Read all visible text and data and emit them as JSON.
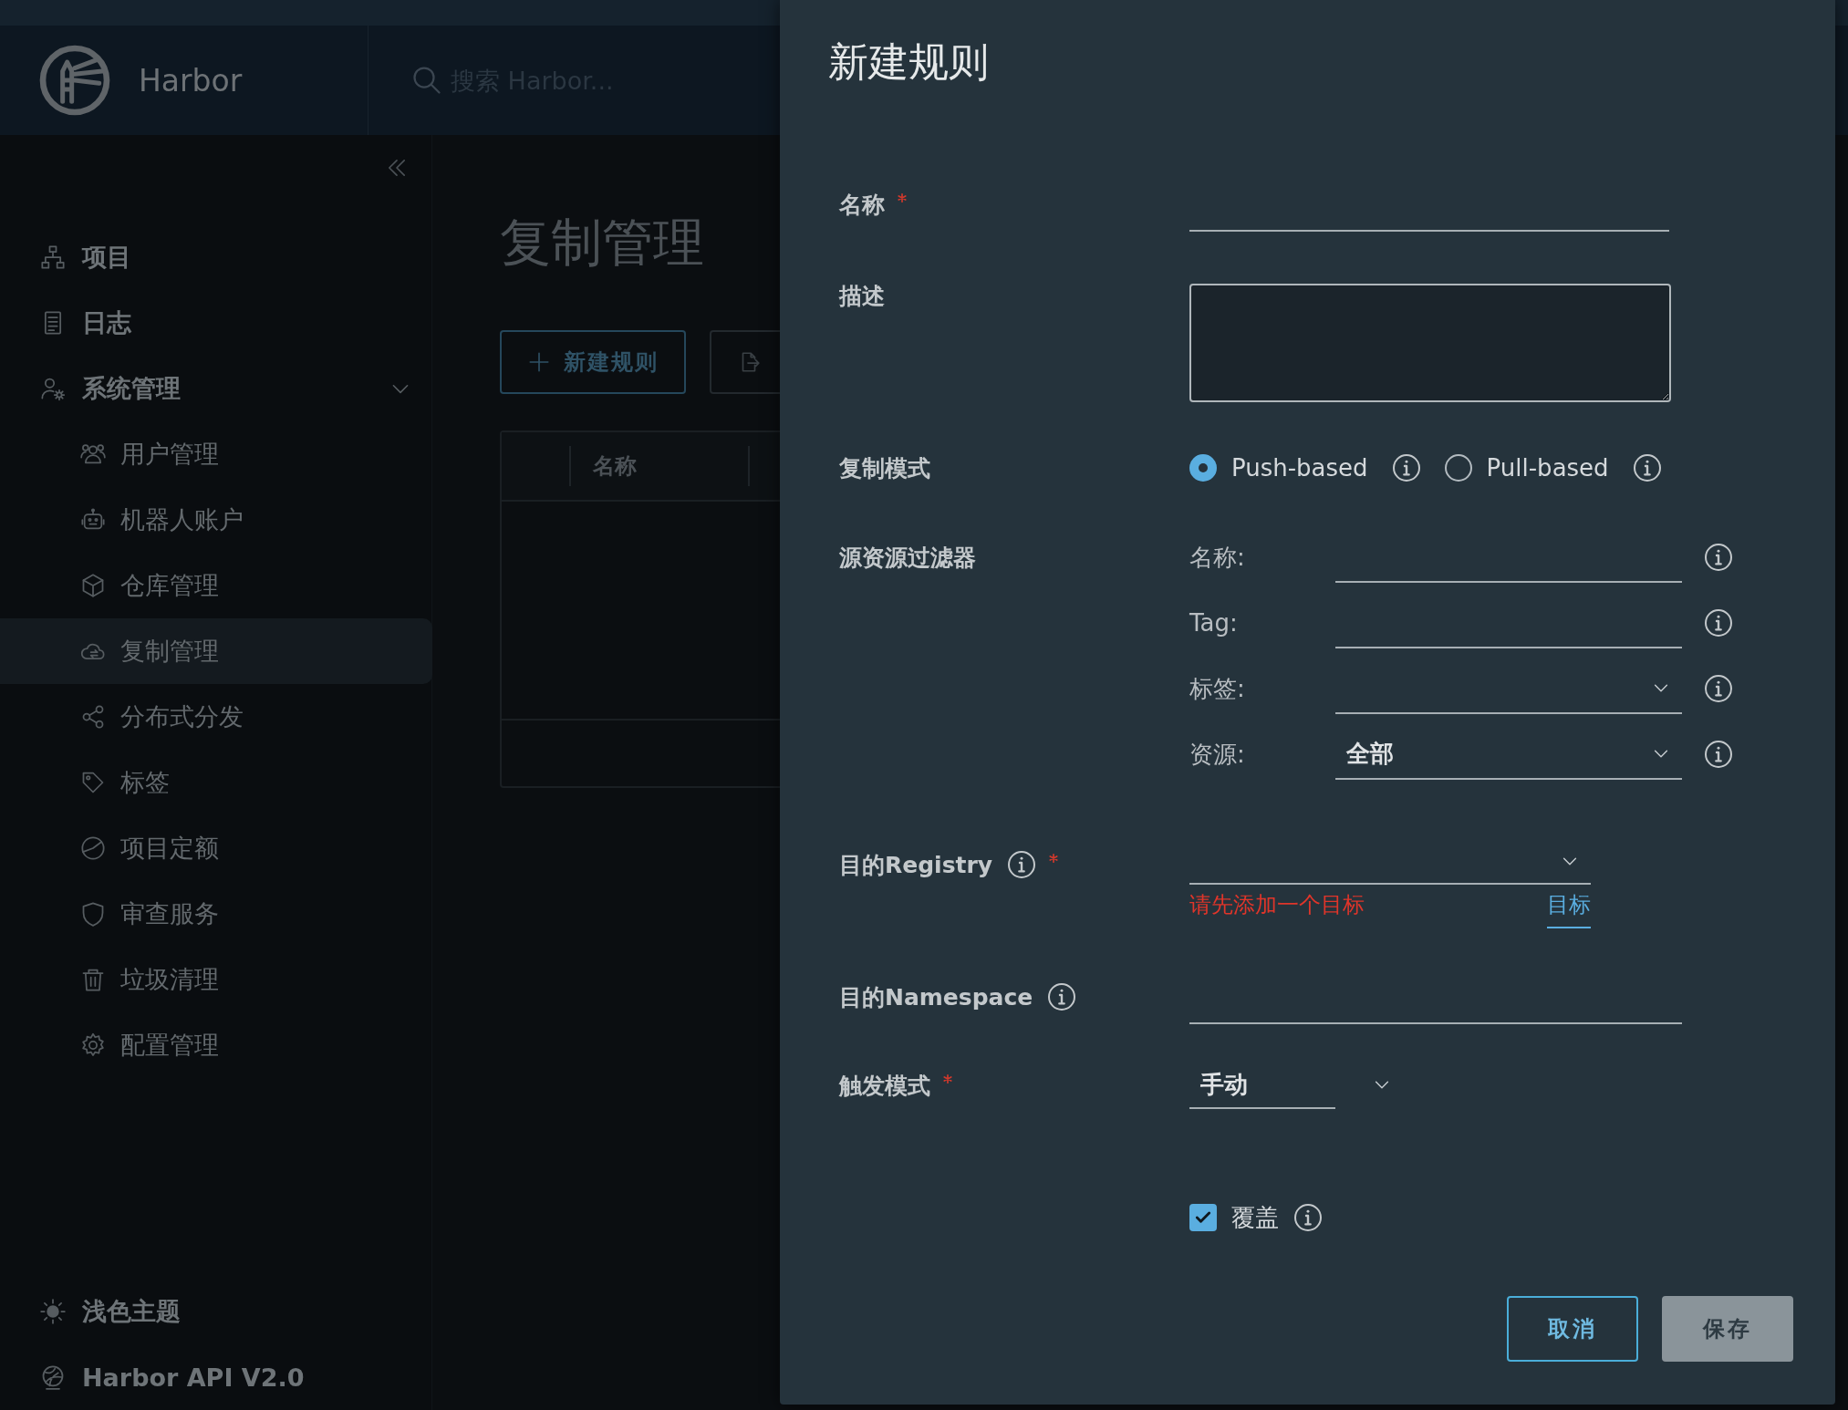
{
  "header": {
    "logo_text": "Harbor",
    "search": {
      "placeholder": "搜索 Harbor..."
    }
  },
  "sidebar": {
    "items": [
      {
        "label": "项目",
        "selected": false
      },
      {
        "label": "日志",
        "selected": false
      },
      {
        "label": "系统管理",
        "selected": false,
        "expanded": true,
        "children": [
          {
            "label": "用户管理",
            "selected": false
          },
          {
            "label": "机器人账户",
            "selected": false
          },
          {
            "label": "仓库管理",
            "selected": false
          },
          {
            "label": "复制管理",
            "selected": true
          },
          {
            "label": "分布式分发",
            "selected": false
          },
          {
            "label": "标签",
            "selected": false
          },
          {
            "label": "项目定额",
            "selected": false
          },
          {
            "label": "审查服务",
            "selected": false
          },
          {
            "label": "垃圾清理",
            "selected": false
          },
          {
            "label": "配置管理",
            "selected": false
          }
        ]
      }
    ],
    "footer_items": [
      "浅色主题",
      "Harbor API V2.0"
    ]
  },
  "page": {
    "title": "复制管理",
    "toolbar": {
      "new_button": "新建规则"
    },
    "table": {
      "columns": [
        "名称"
      ]
    }
  },
  "dialog": {
    "title": "新建规则",
    "fields": [
      {
        "kind": "text",
        "label": "名称",
        "required": true,
        "info": false
      },
      {
        "kind": "textarea",
        "label": "描述",
        "required": false,
        "info": false
      },
      {
        "kind": "radio",
        "label": "复制模式",
        "required": false,
        "info": false,
        "options": [
          {
            "label": "Push-based",
            "selected": true
          },
          {
            "label": "Pull-based",
            "selected": false
          }
        ]
      },
      {
        "kind": "filters",
        "label": "源资源过滤器",
        "required": false,
        "info": false,
        "filters": [
          {
            "kind": "text",
            "label": "名称:"
          },
          {
            "kind": "text",
            "label": "Tag:"
          },
          {
            "kind": "select",
            "label": "标签:"
          },
          {
            "kind": "select",
            "label": "资源:",
            "value": "全部"
          }
        ]
      },
      {
        "kind": "registry",
        "label": "目的Registry",
        "required": true,
        "info": true,
        "error": "请先添加一个目标",
        "link": "目标"
      },
      {
        "kind": "text",
        "label": "目的Namespace",
        "required": false,
        "info": true
      },
      {
        "kind": "dropdown",
        "label": "触发模式",
        "required": true,
        "info": false,
        "value": "手动"
      },
      {
        "kind": "checkbox",
        "label": "覆盖",
        "required": false,
        "info": true,
        "checked": true
      }
    ],
    "buttons": [
      {
        "label": "取消",
        "disabled": false
      },
      {
        "label": "保存",
        "disabled": true
      }
    ]
  }
}
